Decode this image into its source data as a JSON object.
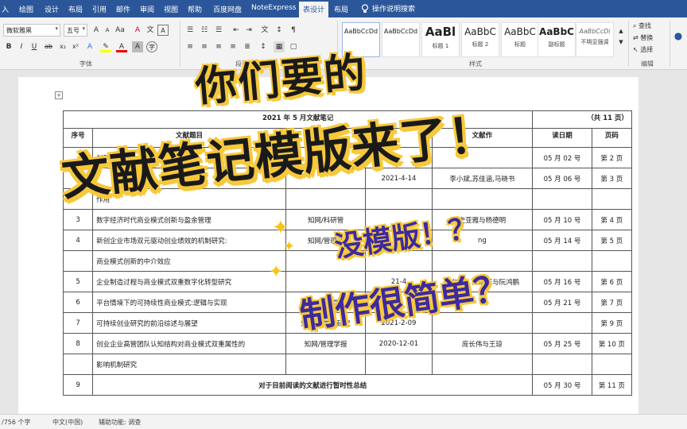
{
  "ribbon_tabs": [
    "入",
    "绘图",
    "设计",
    "布局",
    "引用",
    "邮件",
    "审阅",
    "视图",
    "帮助",
    "百度网盘",
    "NoteExpress",
    "表设计",
    "布局"
  ],
  "tell_me": "操作说明搜索",
  "font": {
    "name": "微软雅黑",
    "size": "五号",
    "group_label": "字体"
  },
  "paragraph_label": "段落",
  "styles": {
    "group_label": "样式",
    "items": [
      {
        "sample": "AaBbCcDd",
        "name": ""
      },
      {
        "sample": "AaBbCcDd",
        "name": ""
      },
      {
        "sample": "AaBl",
        "name": "标题 1"
      },
      {
        "sample": "AaBbC",
        "name": "标题 2"
      },
      {
        "sample": "AaBbC",
        "name": "标题"
      },
      {
        "sample": "AaBbC",
        "name": "副标题"
      },
      {
        "sample": "AaBbCcDi",
        "name": "不明显强调"
      }
    ]
  },
  "editing": {
    "find": "查找",
    "replace": "替换",
    "select": "选择",
    "group_label": "编辑"
  },
  "document": {
    "caption": "2021 年 5 月文献笔记",
    "total_pages": "（共 11 页）",
    "headers": [
      "序号",
      "文献题目",
      "",
      "",
      "文献作",
      "读日期",
      "页码"
    ],
    "rows": [
      {
        "no": "",
        "title": "创新",
        "source": "",
        "date": "",
        "author": "",
        "read": "05 月 02 号",
        "page": "第 2 页"
      },
      {
        "no": "",
        "title": "",
        "source": "",
        "date": "2021-4-14",
        "author": "李小斌,苏佳涵,马晓书",
        "read": "05 月 06 号",
        "page": "第 3 页"
      },
      {
        "no": "",
        "title": "作用",
        "source": "",
        "date": "",
        "author": "",
        "read": "",
        "page": ""
      },
      {
        "no": "3",
        "title": "数字经济时代商业模式创新与盈余管理",
        "source": "知网/科研管",
        "date": "",
        "author": "史亚雅与杨德明",
        "read": "05 月 10 号",
        "page": "第 4 页"
      },
      {
        "no": "4",
        "title": "新创企业市场双元驱动创业绩效的机制研究:",
        "source": "知网/管理评",
        "date": "",
        "author": "ng",
        "read": "05 月 14 号",
        "page": "第 5 页"
      },
      {
        "no": "",
        "title": "商业模式创新的中介效应",
        "source": "",
        "date": "",
        "author": "",
        "read": "",
        "page": ""
      },
      {
        "no": "5",
        "title": "企业制造过程与商业模式双重数字化转型研究",
        "source": "",
        "date": "21-4",
        "author": "魏仁勇、郑瑞钰与阮鸿鹏",
        "read": "05 月 16 号",
        "page": "第 6 页"
      },
      {
        "no": "6",
        "title": "平台情境下的可持续性商业模式:逻辑与实现",
        "source": "知网/科学",
        "date": "",
        "author": "",
        "read": "05 月 21 号",
        "page": "第 7 页"
      },
      {
        "no": "7",
        "title": "可持续创业研究的前沿综述与展望",
        "source": "知网/科学学研究",
        "date": "2021-2-09",
        "author": "",
        "read": "",
        "page": "第 9 页"
      },
      {
        "no": "8",
        "title": "创业企业高管团队认知结构对商业模式双重属性的",
        "source": "知网/管理学报",
        "date": "2020-12-01",
        "author": "庞长伟与王琼",
        "read": "05 月 25 号",
        "page": "第 10 页"
      },
      {
        "no": "",
        "title": "影响机制研究",
        "source": "",
        "date": "",
        "author": "",
        "read": "",
        "page": ""
      },
      {
        "no": "9",
        "title": "对于目前阅读的文献进行暂时性总结",
        "source": "",
        "date": "",
        "author": "",
        "read": "05 月 30 号",
        "page": "第 11 页"
      }
    ]
  },
  "status_bar": {
    "words": "/756 个字",
    "language": "中文(中国)",
    "accessibility": "辅助功能: 调查"
  },
  "overlay": {
    "line1": "你们要的",
    "line2": "文献笔记模版来了！",
    "line3": "没模版！？",
    "line4": "制作很简单？"
  },
  "colors": {
    "ribbon_blue": "#2b579a",
    "highlight_yellow": "#f7c83a",
    "overlay_purple": "#3c2aa0"
  }
}
